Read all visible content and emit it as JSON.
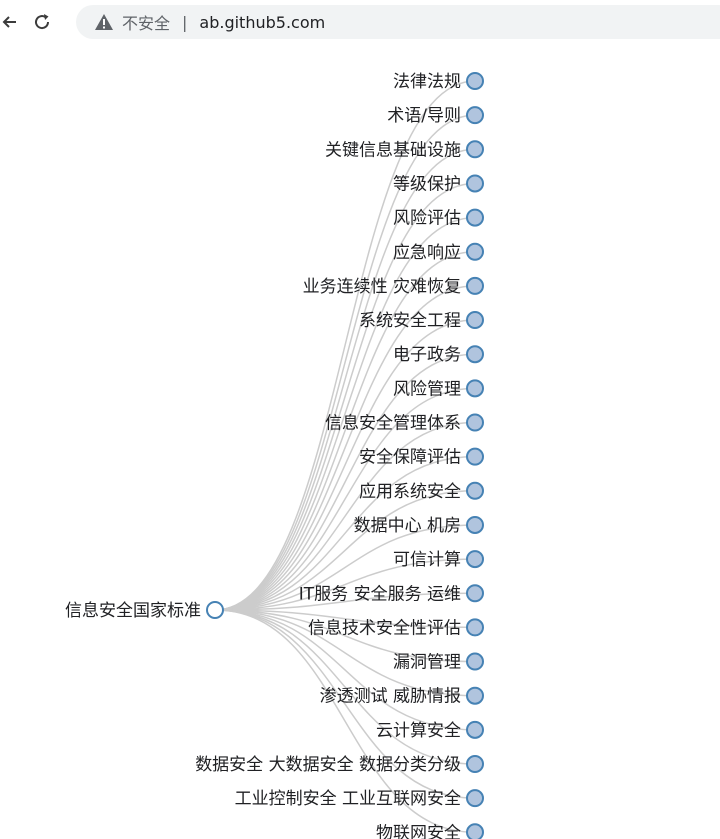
{
  "browser": {
    "security_label": "不安全",
    "separator": "|",
    "url": "ab.github5.com",
    "icons": [
      "back-arrow-icon",
      "reload-icon",
      "warning-icon"
    ]
  },
  "tree": {
    "root": "信息安全国家标准",
    "leaves": [
      "法律法规",
      "术语/导则",
      "关键信息基础设施",
      "等级保护",
      "风险评估",
      "应急响应",
      "业务连续性 灾难恢复",
      "系统安全工程",
      "电子政务",
      "风险管理",
      "信息安全管理体系",
      "安全保障评估",
      "应用系统安全",
      "数据中心 机房",
      "可信计算",
      "IT服务 安全服务 运维",
      "信息技术安全性评估",
      "漏洞管理",
      "渗透测试 威胁情报",
      "云计算安全",
      "数据安全 大数据安全 数据分类分级",
      "工业控制安全 工业互联网安全",
      "物联网安全"
    ],
    "colors": {
      "link": "#cccccc",
      "node_stroke": "#4682b4",
      "leaf_fill": "#b0c4de",
      "root_fill": "#ffffff"
    }
  }
}
